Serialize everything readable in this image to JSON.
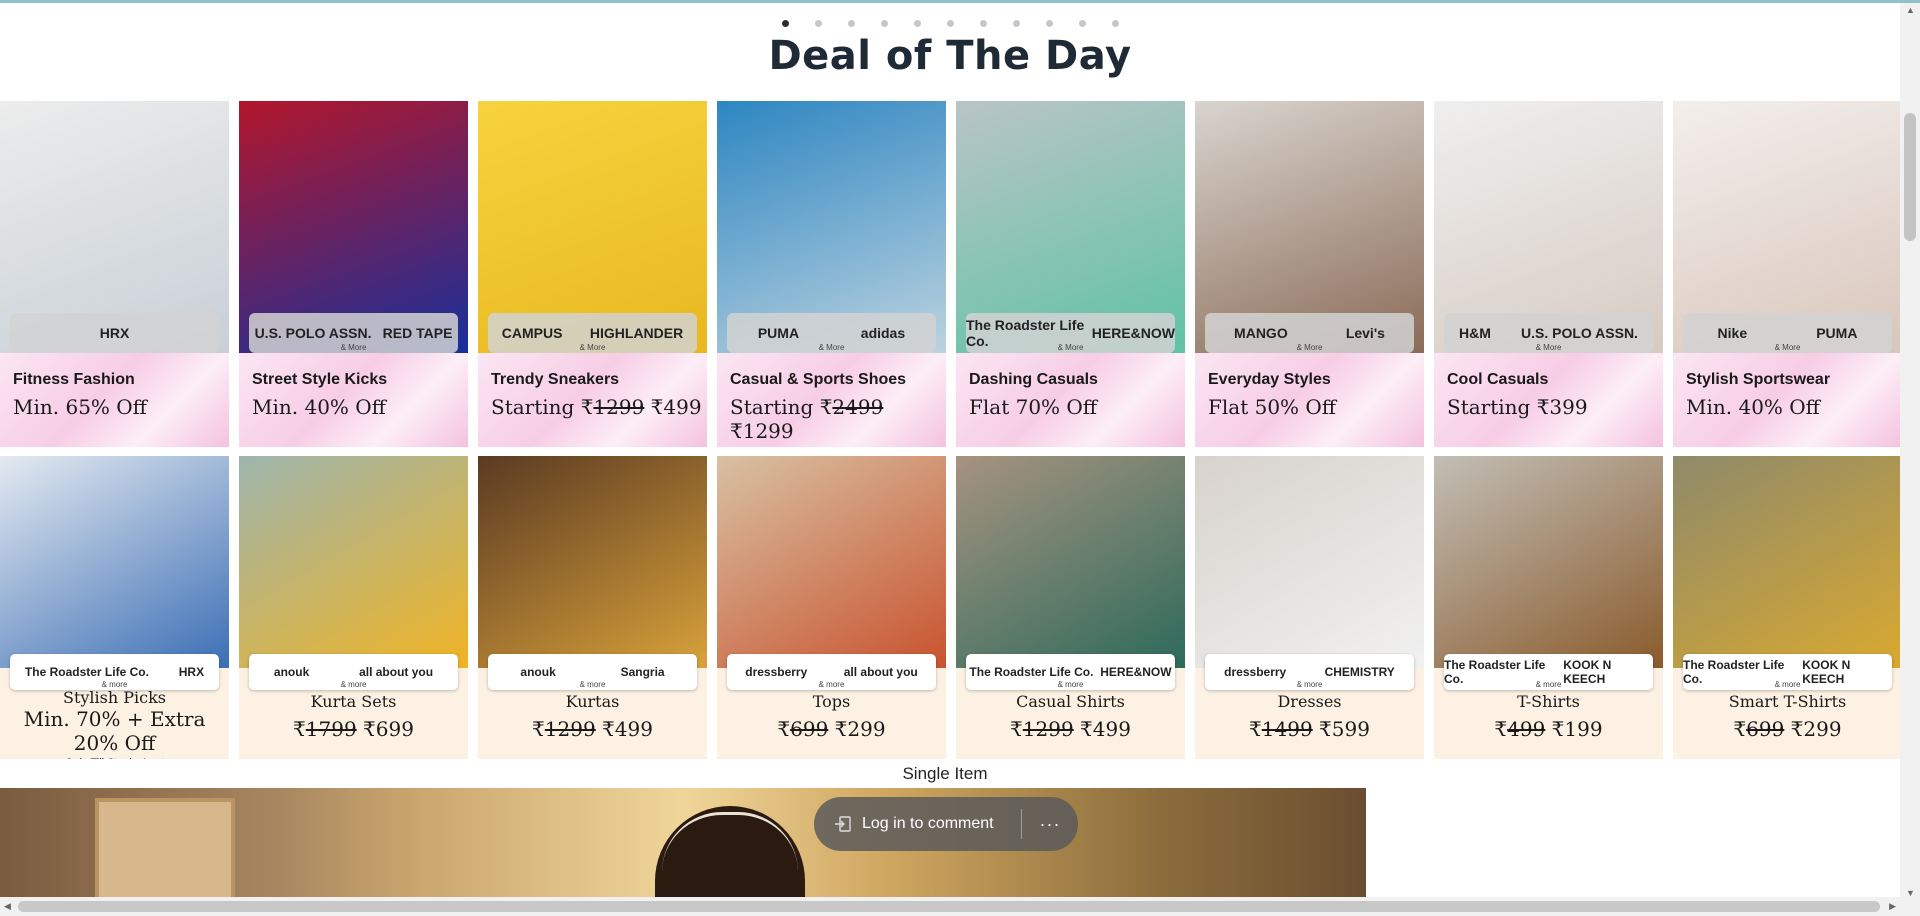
{
  "carousel": {
    "dot_count": 11,
    "active_index": 0
  },
  "heading": "Deal of The Day",
  "row1": [
    {
      "category": "Fitness Fashion",
      "offer": "Min. 65% Off",
      "brands": [
        "HRX",
        ""
      ],
      "more": "",
      "colors": [
        "#ececec",
        "#c8d0d6"
      ]
    },
    {
      "category": "Street Style Kicks",
      "offer": "Min. 40% Off",
      "brands": [
        "U.S. POLO ASSN.",
        "RED TAPE"
      ],
      "more": "& More",
      "colors": [
        "#b3162b",
        "#16309c"
      ]
    },
    {
      "category": "Trendy Sneakers",
      "offer_prefix": "Starting ₹",
      "strike": "1299",
      "offer_suffix": " ₹499",
      "brands": [
        "CAMPUS",
        "HIGHLANDER"
      ],
      "more": "& More",
      "colors": [
        "#f6d33e",
        "#e8b820"
      ]
    },
    {
      "category": "Casual & Sports Shoes",
      "offer_prefix": "Starting ₹",
      "strike": "2499",
      "offer_suffix": " ₹1299",
      "brands": [
        "PUMA",
        "adidas"
      ],
      "more": "& More",
      "colors": [
        "#2d86c2",
        "#bcd3df"
      ]
    },
    {
      "category": "Dashing Casuals",
      "offer": "Flat 70% Off",
      "brands": [
        "The Roadster Life Co.",
        "HERE&NOW"
      ],
      "more": "& More",
      "colors": [
        "#b9c4c7",
        "#5fc3a3"
      ]
    },
    {
      "category": "Everyday Styles",
      "offer": "Flat 50% Off",
      "brands": [
        "MANGO",
        "Levi's"
      ],
      "more": "& More",
      "colors": [
        "#d9d4cf",
        "#8a6b57"
      ]
    },
    {
      "category": "Cool Casuals",
      "offer": "Starting ₹399",
      "brands": [
        "H&M",
        "U.S. POLO ASSN."
      ],
      "more": "& More",
      "colors": [
        "#efefef",
        "#d6cbc2"
      ]
    },
    {
      "category": "Stylish Sportswear",
      "offer": "Min. 40% Off",
      "brands": [
        "Nike",
        "PUMA"
      ],
      "more": "& More",
      "colors": [
        "#f3efec",
        "#d9c6bc"
      ]
    }
  ],
  "row2": [
    {
      "category": "Stylish Picks",
      "price": "Min. 70% + Extra 20% Off",
      "note": "Only Till Stocks Last",
      "brands": [
        "The Roadster Life Co.",
        "HRX"
      ],
      "more": "& more",
      "colors": [
        "#e4eaf0",
        "#3b6eb5"
      ]
    },
    {
      "category": "Kurta Sets",
      "price_prefix": "₹",
      "strike": "1799",
      "price_suffix": " ₹699",
      "brands": [
        "anouk",
        "all about you"
      ],
      "more": "& more",
      "colors": [
        "#9db5ad",
        "#f0b323"
      ]
    },
    {
      "category": "Kurtas",
      "price_prefix": "₹",
      "strike": "1299",
      "price_suffix": " ₹499",
      "brands": [
        "anouk",
        "Sangria"
      ],
      "more": "& more",
      "colors": [
        "#5a3a22",
        "#d9a23a"
      ]
    },
    {
      "category": "Tops",
      "price_prefix": "₹",
      "strike": "699",
      "price_suffix": "  ₹299",
      "brands": [
        "dressberry",
        "all about you"
      ],
      "more": "& more",
      "colors": [
        "#d8c1a3",
        "#c9532e"
      ]
    },
    {
      "category": "Casual Shirts",
      "price_prefix": "₹",
      "strike": "1299",
      "price_suffix": " ₹499",
      "brands": [
        "The Roadster Life Co.",
        "HERE&NOW"
      ],
      "more": "& more",
      "colors": [
        "#a69380",
        "#2d6a5a"
      ]
    },
    {
      "category": "Dresses",
      "price_prefix": "₹",
      "strike": "1499",
      "price_suffix": " ₹599",
      "brands": [
        "dressberry",
        "CHEMISTRY"
      ],
      "more": "& more",
      "colors": [
        "#d7d2cc",
        "#f1f1f1"
      ]
    },
    {
      "category": "T-Shirts",
      "price_prefix": "₹",
      "strike": "499",
      "price_suffix": "  ₹199",
      "brands": [
        "The Roadster Life Co.",
        "KOOK N KEECH"
      ],
      "more": "& more",
      "colors": [
        "#c2beb6",
        "#8a5b2c"
      ]
    },
    {
      "category": "Smart T-Shirts",
      "price_prefix": "₹",
      "strike": "699",
      "price_suffix": "  ₹299",
      "brands": [
        "The Roadster Life Co.",
        "KOOK N KEECH"
      ],
      "more": "& more",
      "colors": [
        "#8e8a6a",
        "#d9a930"
      ]
    }
  ],
  "single_item_label": "Single Item",
  "comment_bar": {
    "login_label": "Log in to comment",
    "more_label": "···"
  }
}
